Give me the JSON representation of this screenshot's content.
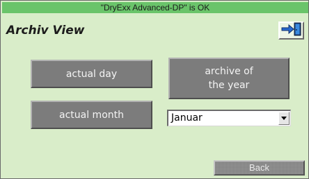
{
  "status": {
    "text": "\"DryExx Advanced-DP\" is OK",
    "color": "#6ac46a"
  },
  "header": {
    "title": "Archiv View",
    "exit_icon": "exit-door-icon"
  },
  "buttons": {
    "actual_day": "actual day",
    "actual_month": "actual month",
    "archive_year_line1": "archive of",
    "archive_year_line2": "the year",
    "back": "Back"
  },
  "month_select": {
    "value": "Januar",
    "arrow_icon": "dropdown-arrow-icon"
  },
  "colors": {
    "background": "#d9edc9",
    "button": "#7c7c7c",
    "status_bar": "#6ac46a"
  }
}
